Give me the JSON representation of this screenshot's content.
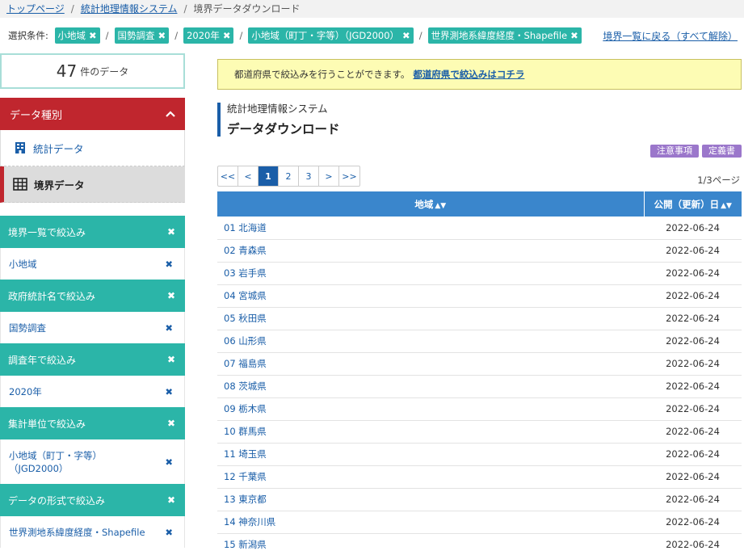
{
  "breadcrumb": {
    "items": [
      "トップページ",
      "統計地理情報システム"
    ],
    "current": "境界データダウンロード"
  },
  "filters": {
    "label": "選択条件:",
    "chips": [
      "小地域",
      "国勢調査",
      "2020年",
      "小地域（町丁・字等）（JGD2000）",
      "世界測地系緯度経度・Shapefile"
    ],
    "remove_glyph": "✖",
    "back_link": "境界一覧に戻る（すべて解除）"
  },
  "sidebar": {
    "count": "47",
    "count_unit": "件のデータ",
    "data_type_title": "データ種別",
    "data_types": [
      {
        "label": "統計データ",
        "icon": "building-icon"
      },
      {
        "label": "境界データ",
        "icon": "grid-icon"
      }
    ],
    "narrowing": [
      {
        "title": "境界一覧で絞込み",
        "value": "小地域"
      },
      {
        "title": "政府統計名で絞込み",
        "value": "国勢調査"
      },
      {
        "title": "調査年で絞込み",
        "value": "2020年"
      },
      {
        "title": "集計単位で絞込み",
        "value": "小地域（町丁・字等）\n（JGD2000）"
      },
      {
        "title": "データの形式で絞込み",
        "value": "世界測地系緯度経度・Shapefile"
      }
    ]
  },
  "notice": {
    "text": "都道府県で絞込みを行うことができます。",
    "link": "都道府県で絞込みはコチラ"
  },
  "heading": {
    "subtitle": "統計地理情報システム",
    "title": "データダウンロード"
  },
  "tags": [
    "注意事項",
    "定義書"
  ],
  "pagination": {
    "buttons": [
      "<<",
      "<",
      "1",
      "2",
      "3",
      ">",
      ">>"
    ],
    "active": "1",
    "info": "1/3ページ"
  },
  "table": {
    "headers": [
      "地域",
      "公開（更新）日"
    ],
    "rows": [
      [
        "01 北海道",
        "2022-06-24"
      ],
      [
        "02 青森県",
        "2022-06-24"
      ],
      [
        "03 岩手県",
        "2022-06-24"
      ],
      [
        "04 宮城県",
        "2022-06-24"
      ],
      [
        "05 秋田県",
        "2022-06-24"
      ],
      [
        "06 山形県",
        "2022-06-24"
      ],
      [
        "07 福島県",
        "2022-06-24"
      ],
      [
        "08 茨城県",
        "2022-06-24"
      ],
      [
        "09 栃木県",
        "2022-06-24"
      ],
      [
        "10 群馬県",
        "2022-06-24"
      ],
      [
        "11 埼玉県",
        "2022-06-24"
      ],
      [
        "12 千葉県",
        "2022-06-24"
      ],
      [
        "13 東京都",
        "2022-06-24"
      ],
      [
        "14 神奈川県",
        "2022-06-24"
      ],
      [
        "15 新潟県",
        "2022-06-24"
      ]
    ]
  },
  "colors": {
    "teal": "#2bb5a8",
    "red": "#c0262e",
    "blue": "#3a86cc",
    "purple": "#9b77cb",
    "notice_bg": "#fdfcb4"
  }
}
